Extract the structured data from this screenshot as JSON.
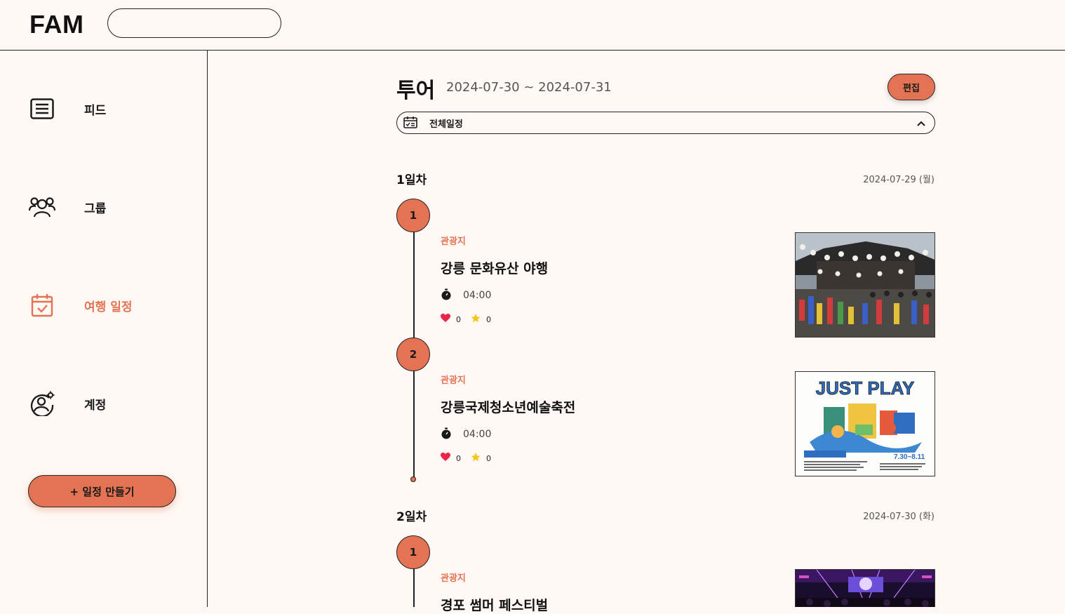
{
  "header": {
    "logo": "FAM",
    "search_placeholder": ""
  },
  "sidebar": {
    "items": [
      {
        "label": "피드"
      },
      {
        "label": "그룹"
      },
      {
        "label": "여행 일정"
      },
      {
        "label": "계정"
      }
    ],
    "create_button": "+ 일정 만들기",
    "active": "여행 일정"
  },
  "trip": {
    "title": "투어",
    "dates": "2024-07-30 ~ 2024-07-31",
    "edit_label": "편집",
    "schedule_filter": "전체일정"
  },
  "days": [
    {
      "title": "1일차",
      "date": "2024-07-29 (월)",
      "stops": [
        {
          "num": "1",
          "category": "관광지",
          "name": "강릉 문화유산 야행",
          "time": "04:00",
          "likes": "0",
          "stars": "0"
        },
        {
          "num": "2",
          "category": "관광지",
          "name": "강릉국제청소년예술축전",
          "time": "04:00",
          "likes": "0",
          "stars": "0"
        }
      ]
    },
    {
      "title": "2일차",
      "date": "2024-07-30 (화)",
      "stops": [
        {
          "num": "1",
          "category": "관광지",
          "name": "경포 썸머 페스티벌"
        }
      ]
    }
  ],
  "poster": {
    "headline": "JUST PLAY",
    "dates": "7.30~8.11"
  },
  "colors": {
    "accent": "#e37352",
    "background": "#fff8f4",
    "heart": "#e8254a",
    "star": "#f5c518"
  }
}
